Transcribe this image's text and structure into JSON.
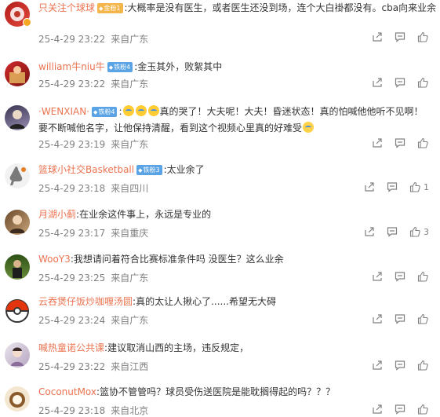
{
  "comments": [
    {
      "username": "只关注个球球",
      "badge": "金粉1",
      "badge_style": "gold",
      "text": "大概率是没有医生，或者医生还没到场，连个大白褂都没有。cba向来业余",
      "date": "25-4-29 23:22",
      "source": "来自广东",
      "likes": ""
    },
    {
      "username": "william牛niu牛",
      "badge": "铁粉4",
      "badge_style": "blue",
      "text": "金玉其外，败絮其中",
      "date": "25-4-29 23:22",
      "source": "来自广东",
      "likes": ""
    },
    {
      "username": "·WENXIAN·",
      "badge": "铁粉4",
      "badge_style": "blue",
      "text_before": "",
      "text": "真的哭了！大夫呢！大夫！昏迷状态！真的怕喊他他听不见啊！要不断喊他名字，让他保持清醒，看到这个视频心里真的好难受",
      "date": "25-4-29 23:19",
      "source": "来自广东",
      "likes": ""
    },
    {
      "username": "篮球小社交Basketball",
      "badge": "铁粉3",
      "badge_style": "blue",
      "text": "太业余了",
      "date": "25-4-29 23:18",
      "source": "来自四川",
      "likes": "1"
    },
    {
      "username": "月湖小蓟",
      "badge": "",
      "text": "在业余这件事上，永远是专业的",
      "date": "25-4-29 23:17",
      "source": "来自重庆",
      "likes": "3"
    },
    {
      "username": "WooY3",
      "badge": "",
      "text": "我想请问着符合比赛标准条件吗 没医生？这么业余",
      "date": "25-4-29 23:25",
      "source": "来自广东",
      "likes": ""
    },
    {
      "username": "云吞煲仔饭炒咖喱汤圆",
      "badge": "",
      "text": "真的太让人揪心了......希望无大碍",
      "date": "25-4-29 23:24",
      "source": "来自广东",
      "likes": ""
    },
    {
      "username": "喊热童诺公共课",
      "badge": "",
      "text": "建议取消山西的主场，违反规定，",
      "date": "25-4-29 23:22",
      "source": "来自江西",
      "likes": ""
    },
    {
      "username": "CoconutMox",
      "badge": "",
      "text": "篮协不管管吗？球员受伤送医院是能耽搁得起的吗？？？",
      "date": "25-4-29 23:18",
      "source": "来自北京",
      "likes": ""
    }
  ],
  "colors": {
    "username": "#eb7350",
    "meta": "#808080",
    "badge_blue": "#5aa3e4",
    "badge_gold": "#f4b64a"
  },
  "icons": [
    "share-icon",
    "comment-icon",
    "like-icon"
  ]
}
